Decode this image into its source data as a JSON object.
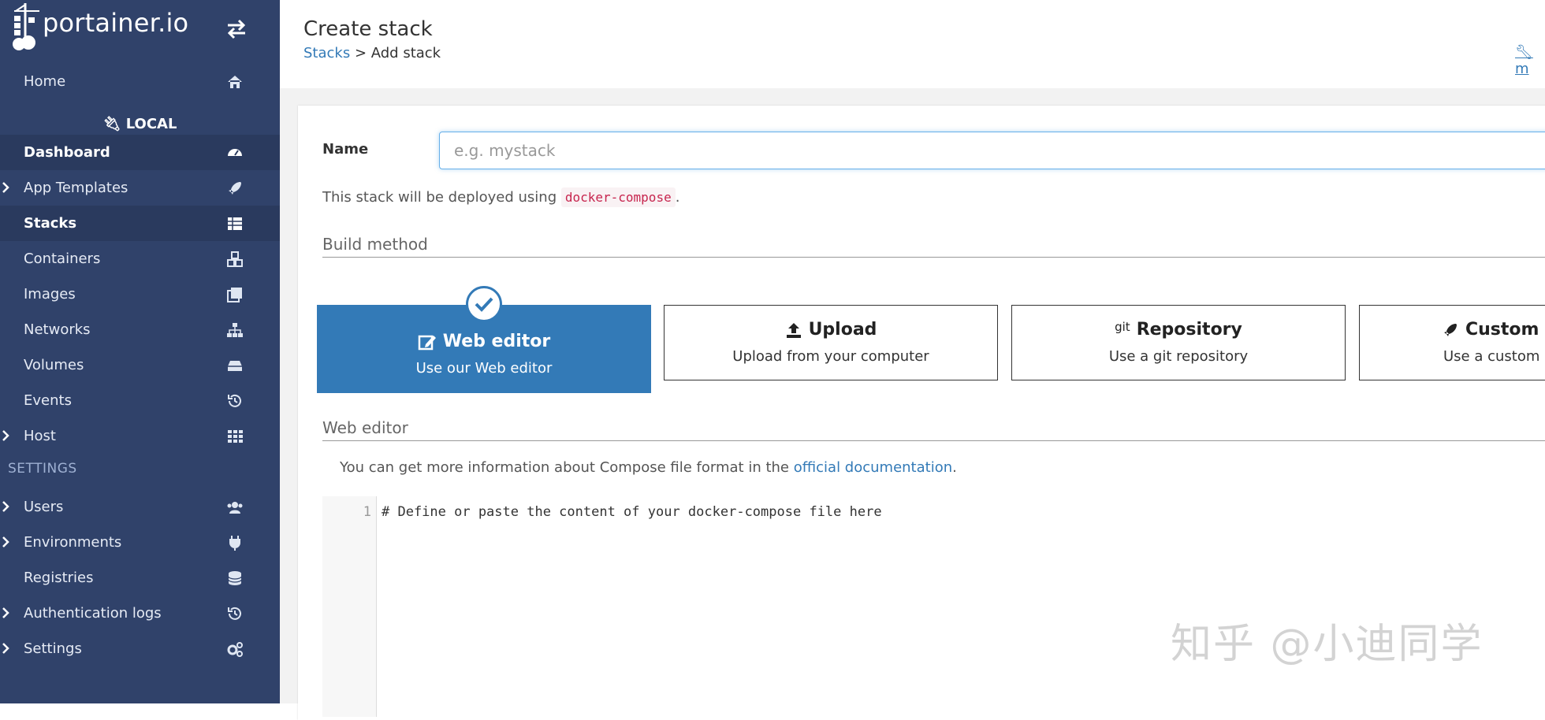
{
  "sidebar": {
    "logo_text": "portainer.io",
    "environment": "LOCAL",
    "settings_title": "SETTINGS",
    "items": [
      {
        "label": "Home",
        "icon": "home-icon"
      },
      {
        "label": "Dashboard",
        "icon": "dashboard-icon"
      },
      {
        "label": "App Templates",
        "icon": "rocket-icon"
      },
      {
        "label": "Stacks",
        "icon": "stacks-icon"
      },
      {
        "label": "Containers",
        "icon": "cubes-icon"
      },
      {
        "label": "Images",
        "icon": "images-icon"
      },
      {
        "label": "Networks",
        "icon": "network-icon"
      },
      {
        "label": "Volumes",
        "icon": "hdd-icon"
      },
      {
        "label": "Events",
        "icon": "history-icon"
      },
      {
        "label": "Host",
        "icon": "grid-icon"
      },
      {
        "label": "Users",
        "icon": "users-icon"
      },
      {
        "label": "Environments",
        "icon": "plug-icon"
      },
      {
        "label": "Registries",
        "icon": "database-icon"
      },
      {
        "label": "Authentication logs",
        "icon": "history-icon"
      },
      {
        "label": "Settings",
        "icon": "cogs-icon"
      }
    ]
  },
  "header": {
    "title": "Create stack",
    "breadcrumb_link": "Stacks",
    "breadcrumb_separator": " > ",
    "breadcrumb_current": "Add stack",
    "right_link": "m"
  },
  "form": {
    "name_label": "Name",
    "name_placeholder": "e.g. mystack",
    "deploy_note_prefix": "This stack will be deployed using ",
    "deploy_note_code": "docker-compose",
    "deploy_note_suffix": "."
  },
  "build_method": {
    "title": "Build method",
    "options": [
      {
        "title": "Web editor",
        "desc": "Use our Web editor",
        "icon": "edit-icon",
        "selected": true
      },
      {
        "title": "Upload",
        "desc": "Upload from your computer",
        "icon": "upload-icon"
      },
      {
        "title": "Repository",
        "desc": "Use a git repository",
        "icon": "git",
        "icon_text": "git"
      },
      {
        "title": "Custom te",
        "desc": "Use a custom",
        "icon": "rocket-icon"
      }
    ]
  },
  "web_editor": {
    "title": "Web editor",
    "info_prefix": "You can get more information about Compose file format in the ",
    "info_link": "official documentation",
    "info_suffix": ".",
    "line_number": "1",
    "line_content": "# Define or paste the content of your docker-compose file here"
  },
  "watermark": "知乎 @小迪同学",
  "colors": {
    "sidebar_bg": "#30426a",
    "accent": "#337ab7"
  }
}
